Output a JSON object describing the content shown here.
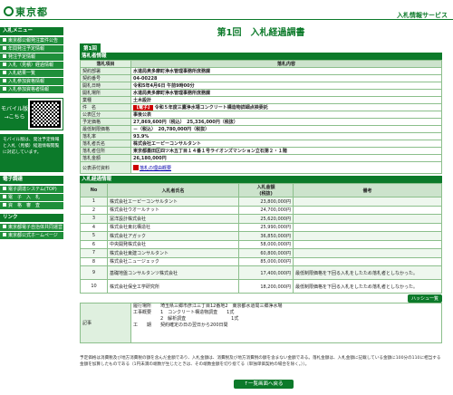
{
  "header": {
    "logo": "東京都",
    "service": "入札情報サービス"
  },
  "side": {
    "section1": "入札メニュー",
    "items": [
      "東京都公報発注案件公告",
      "年間発注予定情報",
      "発注予定情報",
      "入札（見積）経過情報",
      "入札結果一覧",
      "入札参加資格情報",
      "入札参加資格者情報"
    ],
    "mobile_label": "モバイル版",
    "mobile_sub": "→こちら",
    "note": "モバイル版は、発注予定情報と入札（見積）経過情報閲覧に対応しています。",
    "section2": "電子調達",
    "links2": [
      "電子調達システム(TOP)",
      "電　子　入　札",
      "資　格　審　査"
    ],
    "section3": "リンク",
    "links3": [
      "東京都電子自治体共同運営",
      "東京都公式ホームページ"
    ]
  },
  "main": {
    "title": "第1回　入札経過調書",
    "caption": "第1回",
    "block1": "落札者情報",
    "head_item": "落札項目",
    "head_content": "落札内容",
    "rows": [
      {
        "label": "契約部署",
        "value": "水道局奥多摩町浄水管理事務所庶務課"
      },
      {
        "label": "契約番号",
        "value": "04-00228"
      },
      {
        "label": "開札日時",
        "value": "令和5年4月6日 午前9時00分"
      },
      {
        "label": "開札場所",
        "value": "水道局奥多摩町浄水管理事務所庶務課"
      },
      {
        "label": "業種",
        "value": "土木設計"
      }
    ],
    "kenmei_label": "件　名",
    "kenmei_tag": "【電子】",
    "kenmei_text": "令和５年度三鷹浄水場コンクリート構造物詳細点検委託",
    "rows2": [
      {
        "label": "公表区分",
        "value": "事後公表"
      },
      {
        "label": "予定価格",
        "value": "27,869,600円（税込）　25,336,000円（税抜）"
      },
      {
        "label": "最低制限価格",
        "value": "－（税込）　20,780,000円（税抜）"
      },
      {
        "label": "落札率",
        "value": "93.9%"
      }
    ],
    "winner_label": "落札者氏名",
    "winner": "株式会社エーピーコンサルタント",
    "addr_label": "落札者住所",
    "addr": "東京都墨田区四ツ木五丁目１４番１号ライオンズマンション立石第２・１階",
    "price_label": "落札金額",
    "price": "26,180,000円",
    "pub_label": "公表添付資料",
    "pub_link": "落札の理由概要",
    "block2": "入札経過情報",
    "bid_heads": [
      "No",
      "入札者氏名",
      "入札金額\n(税抜)",
      "備考"
    ],
    "bids": [
      {
        "no": "1",
        "name": "株式会社エーピーコンサルタント",
        "amount": "23,800,000円",
        "note": ""
      },
      {
        "no": "2",
        "name": "株式会社ウオールナット",
        "amount": "24,700,000円",
        "note": ""
      },
      {
        "no": "3",
        "name": "冨洋設計株式会社",
        "amount": "25,620,000円",
        "note": ""
      },
      {
        "no": "4",
        "name": "株式会社東北構造社",
        "amount": "25,990,000円",
        "note": ""
      },
      {
        "no": "5",
        "name": "株式会社アガック",
        "amount": "36,850,000円",
        "note": ""
      },
      {
        "no": "6",
        "name": "中央開発株式会社",
        "amount": "58,000,000円",
        "note": ""
      },
      {
        "no": "7",
        "name": "株式会社東建コンサルタント",
        "amount": "60,800,000円",
        "note": ""
      },
      {
        "no": "8",
        "name": "株式会社ニュージェック",
        "amount": "85,000,000円",
        "note": ""
      },
      {
        "no": "9",
        "name": "基礎地盤コンサルタンツ株式会社",
        "amount": "17,400,000円",
        "note": "最低制限価格を下回る入札をしたため落札者としなかった。"
      },
      {
        "no": "10",
        "name": "株式会社保全工学研究所",
        "amount": "18,200,000円",
        "note": "最低制限価格を下回る入札をしたため落札者としなかった。"
      }
    ],
    "list_btn": "ハッシュ一覧",
    "memo_label": "記事",
    "memo": [
      "履行場所　　埼玉県三郷市彦江三丁目12番地2　東京都水道局三郷浄水場",
      "工事概要　　1　コンクリート構造物調査　　1式",
      "　　　　　　2　解析調査　　　　　　　　　　1式",
      "工　　期　　契約確定の日の翌日から200日間"
    ]
  },
  "footer": "予定価格は消費税及び地方消費税の額を含んだ金額であり、入札金額は、消費税及び地方消費税の額を含まない金額である。落札金額は、入札金額に記載している金額に100分の110に相当する金額を加算したものである（1円未満の端数が生じたときは、その端数金額を切り捨てる（単独単価契約の場合を除く。））。",
  "back_btn": "↑一覧画面へ戻る"
}
